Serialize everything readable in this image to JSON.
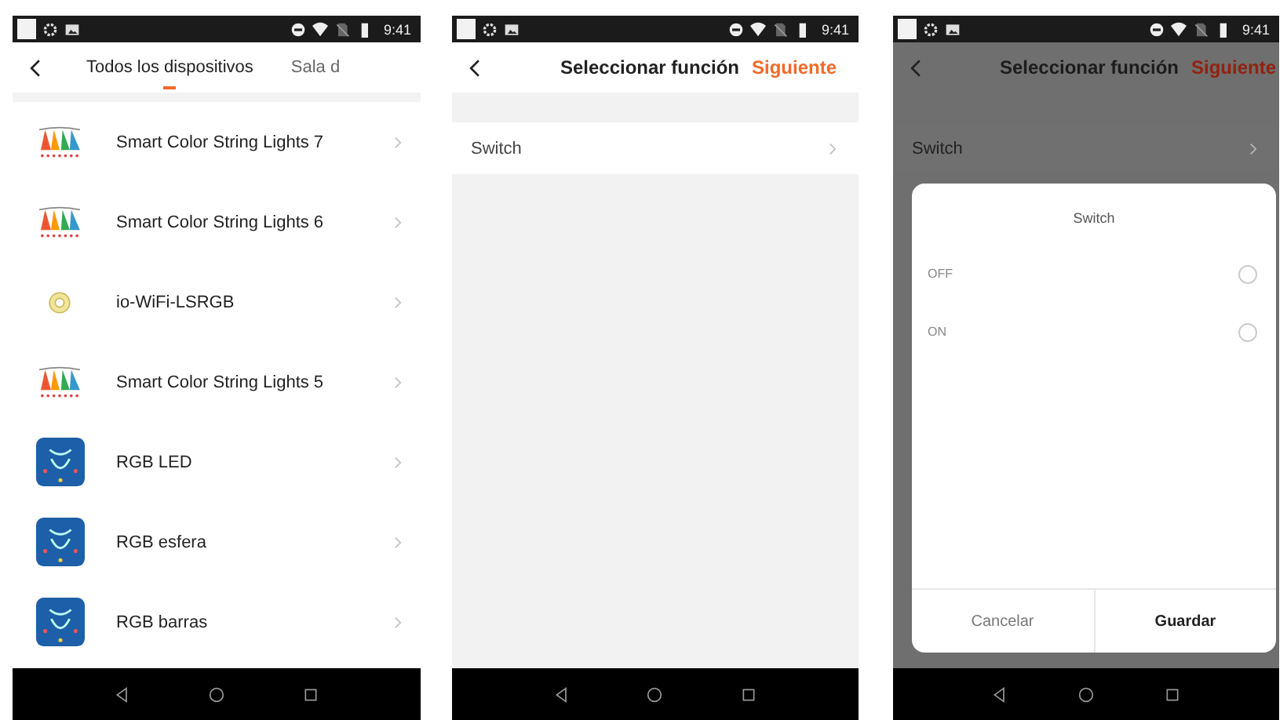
{
  "screens": [
    {
      "kind": "device-list",
      "status_time": "9:41",
      "tabs": [
        {
          "label": "Todos los dispositivos",
          "selected": true
        },
        {
          "label": "Sala d",
          "selected": false
        }
      ],
      "devices": [
        {
          "name": "Smart Color String Lights 7",
          "kind": "string-lights"
        },
        {
          "name": "Smart Color String Lights 6",
          "kind": "string-lights"
        },
        {
          "name": "io-WiFi-LSRGB",
          "kind": "ring"
        },
        {
          "name": "Smart Color String Lights 5",
          "kind": "string-lights"
        },
        {
          "name": "RGB LED",
          "kind": "app"
        },
        {
          "name": "RGB esfera",
          "kind": "app"
        },
        {
          "name": "RGB barras",
          "kind": "app"
        }
      ]
    },
    {
      "kind": "function-select",
      "status_time": "9:41",
      "title": "Seleccionar función",
      "action": "Siguiente",
      "functions": [
        "Switch"
      ],
      "dimmed": false
    },
    {
      "kind": "function-select",
      "status_time": "9:41",
      "title": "Seleccionar función",
      "action": "Siguiente",
      "functions": [
        "Switch"
      ],
      "dimmed": true,
      "dialog": {
        "title": "Switch",
        "options": [
          {
            "label": "OFF",
            "selected": false
          },
          {
            "label": "ON",
            "selected": false
          }
        ],
        "cancel": "Cancelar",
        "save": "Guardar"
      }
    }
  ]
}
